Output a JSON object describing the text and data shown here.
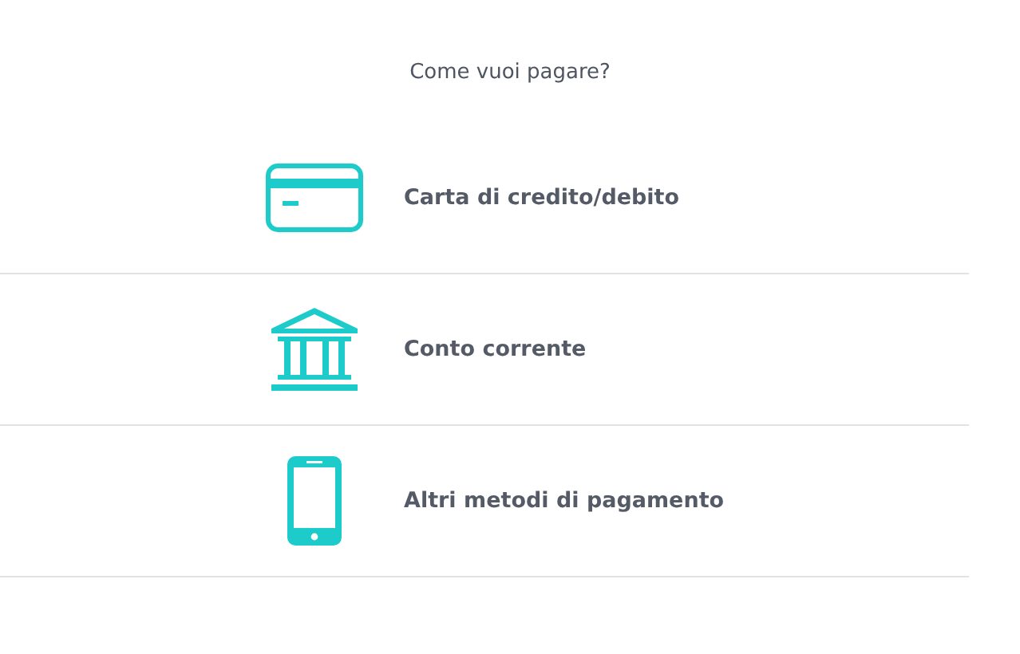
{
  "heading": "Come vuoi pagare?",
  "options": [
    {
      "kind": "card",
      "label": "Carta di credito/debito"
    },
    {
      "kind": "bank",
      "label": "Conto corrente"
    },
    {
      "kind": "phone",
      "label": "Altri metodi di pagamento"
    }
  ]
}
